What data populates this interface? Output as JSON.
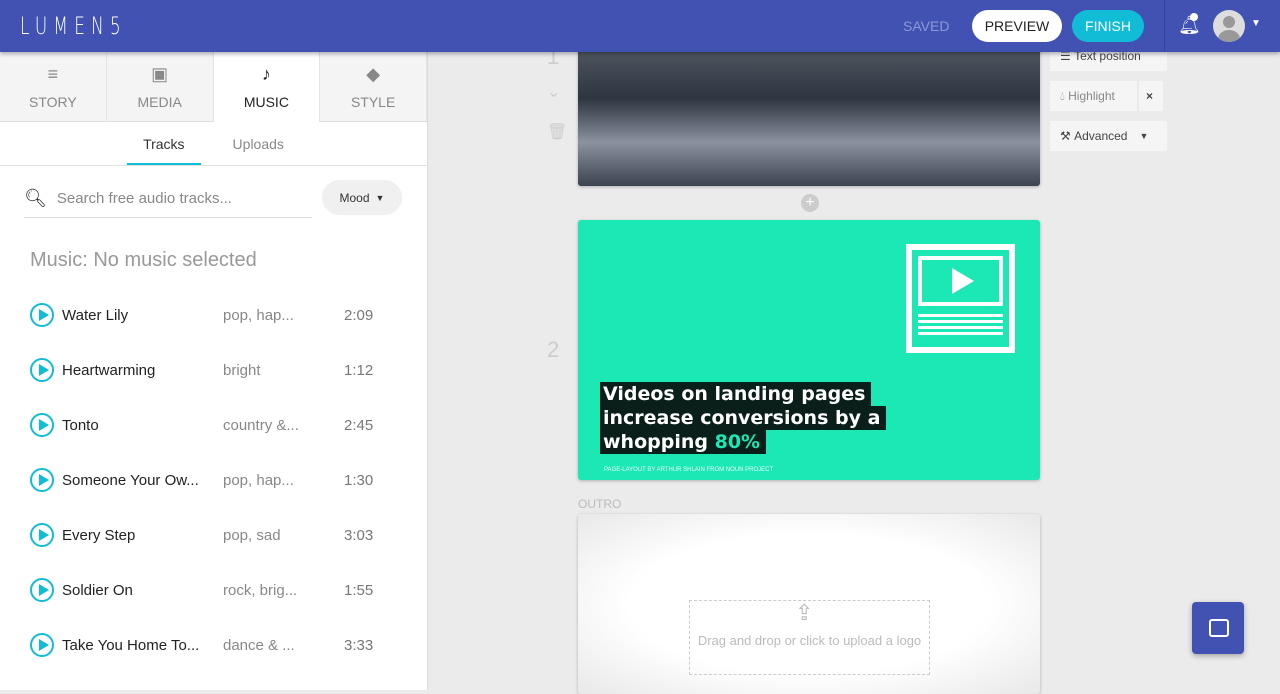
{
  "header": {
    "logo": "LUMEN5",
    "saved": "SAVED",
    "preview": "PREVIEW",
    "finish": "FINISH"
  },
  "tabs": [
    {
      "label": "STORY",
      "icon": "≡"
    },
    {
      "label": "MEDIA",
      "icon": "▣"
    },
    {
      "label": "MUSIC",
      "icon": "♪"
    },
    {
      "label": "STYLE",
      "icon": "◆"
    }
  ],
  "subtabs": [
    "Tracks",
    "Uploads"
  ],
  "search": {
    "placeholder": "Search free audio tracks...",
    "mood": "Mood"
  },
  "music_title": "Music: No music selected",
  "tracks": [
    {
      "name": "Water Lily",
      "tags": "pop, hap...",
      "duration": "2:09"
    },
    {
      "name": "Heartwarming",
      "tags": "bright",
      "duration": "1:12"
    },
    {
      "name": "Tonto",
      "tags": "country &...",
      "duration": "2:45"
    },
    {
      "name": "Someone Your Ow...",
      "tags": "pop, hap...",
      "duration": "1:30"
    },
    {
      "name": "Every Step",
      "tags": "pop, sad",
      "duration": "3:03"
    },
    {
      "name": "Soldier On",
      "tags": "rock, brig...",
      "duration": "1:55"
    },
    {
      "name": "Take You Home To...",
      "tags": "dance & ...",
      "duration": "3:33"
    }
  ],
  "slides": {
    "one_number": "1",
    "two_number": "2",
    "headline": [
      "Videos on landing pages",
      "increase conversions by a",
      "whopping "
    ],
    "highlight": "80%",
    "credit": "PAGE-LAYOUT BY ARTHUR SHLAIN FROM NOUN PROJECT",
    "outro_label": "OUTRO",
    "drop_text": "Drag and drop or click to upload a logo"
  },
  "tools": {
    "text_position": "Text position",
    "highlight": "Highlight",
    "close": "×",
    "advanced": "Advanced"
  }
}
